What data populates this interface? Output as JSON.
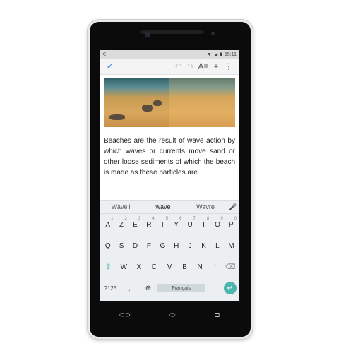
{
  "status": {
    "time": "15:11"
  },
  "document": {
    "body": "Beaches are the result of wave action by which waves or currents move sand or other loose sediments of which the beach is made as these particles are"
  },
  "keyboard": {
    "suggestions": [
      "Wavell",
      "wave",
      "Wavre"
    ],
    "rows": [
      [
        "A",
        "Z",
        "E",
        "R",
        "T",
        "Y",
        "U",
        "I",
        "O",
        "P"
      ],
      [
        "Q",
        "S",
        "D",
        "F",
        "G",
        "H",
        "J",
        "K",
        "L",
        "M"
      ],
      [
        "W",
        "X",
        "C",
        "V",
        "B",
        "N",
        "'"
      ]
    ],
    "hints": [
      "1",
      "2",
      "3",
      "4",
      "5",
      "6",
      "7",
      "8",
      "9",
      "0"
    ],
    "symbols_label": "?123",
    "comma": ",",
    "period": ".",
    "space_label": "Français"
  }
}
